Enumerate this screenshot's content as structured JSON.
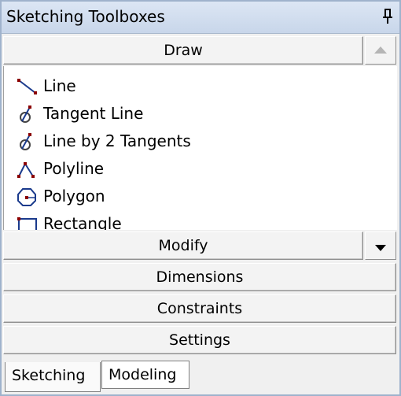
{
  "window": {
    "title": "Sketching Toolboxes"
  },
  "sections": {
    "draw": "Draw",
    "modify": "Modify",
    "dimensions": "Dimensions",
    "constraints": "Constraints",
    "settings": "Settings"
  },
  "draw_items": [
    {
      "label": "Line",
      "icon": "line-icon"
    },
    {
      "label": "Tangent Line",
      "icon": "tangent-line-icon"
    },
    {
      "label": "Line by 2 Tangents",
      "icon": "line-by-2-tangents-icon"
    },
    {
      "label": "Polyline",
      "icon": "polyline-icon"
    },
    {
      "label": "Polygon",
      "icon": "polygon-icon"
    },
    {
      "label": "Rectangle",
      "icon": "rectangle-icon"
    }
  ],
  "tabs": [
    {
      "label": "Sketching",
      "active": true
    },
    {
      "label": "Modeling",
      "active": false
    }
  ],
  "colors": {
    "icon_point": "#8b0000",
    "icon_stroke": "#1a3a8c"
  }
}
